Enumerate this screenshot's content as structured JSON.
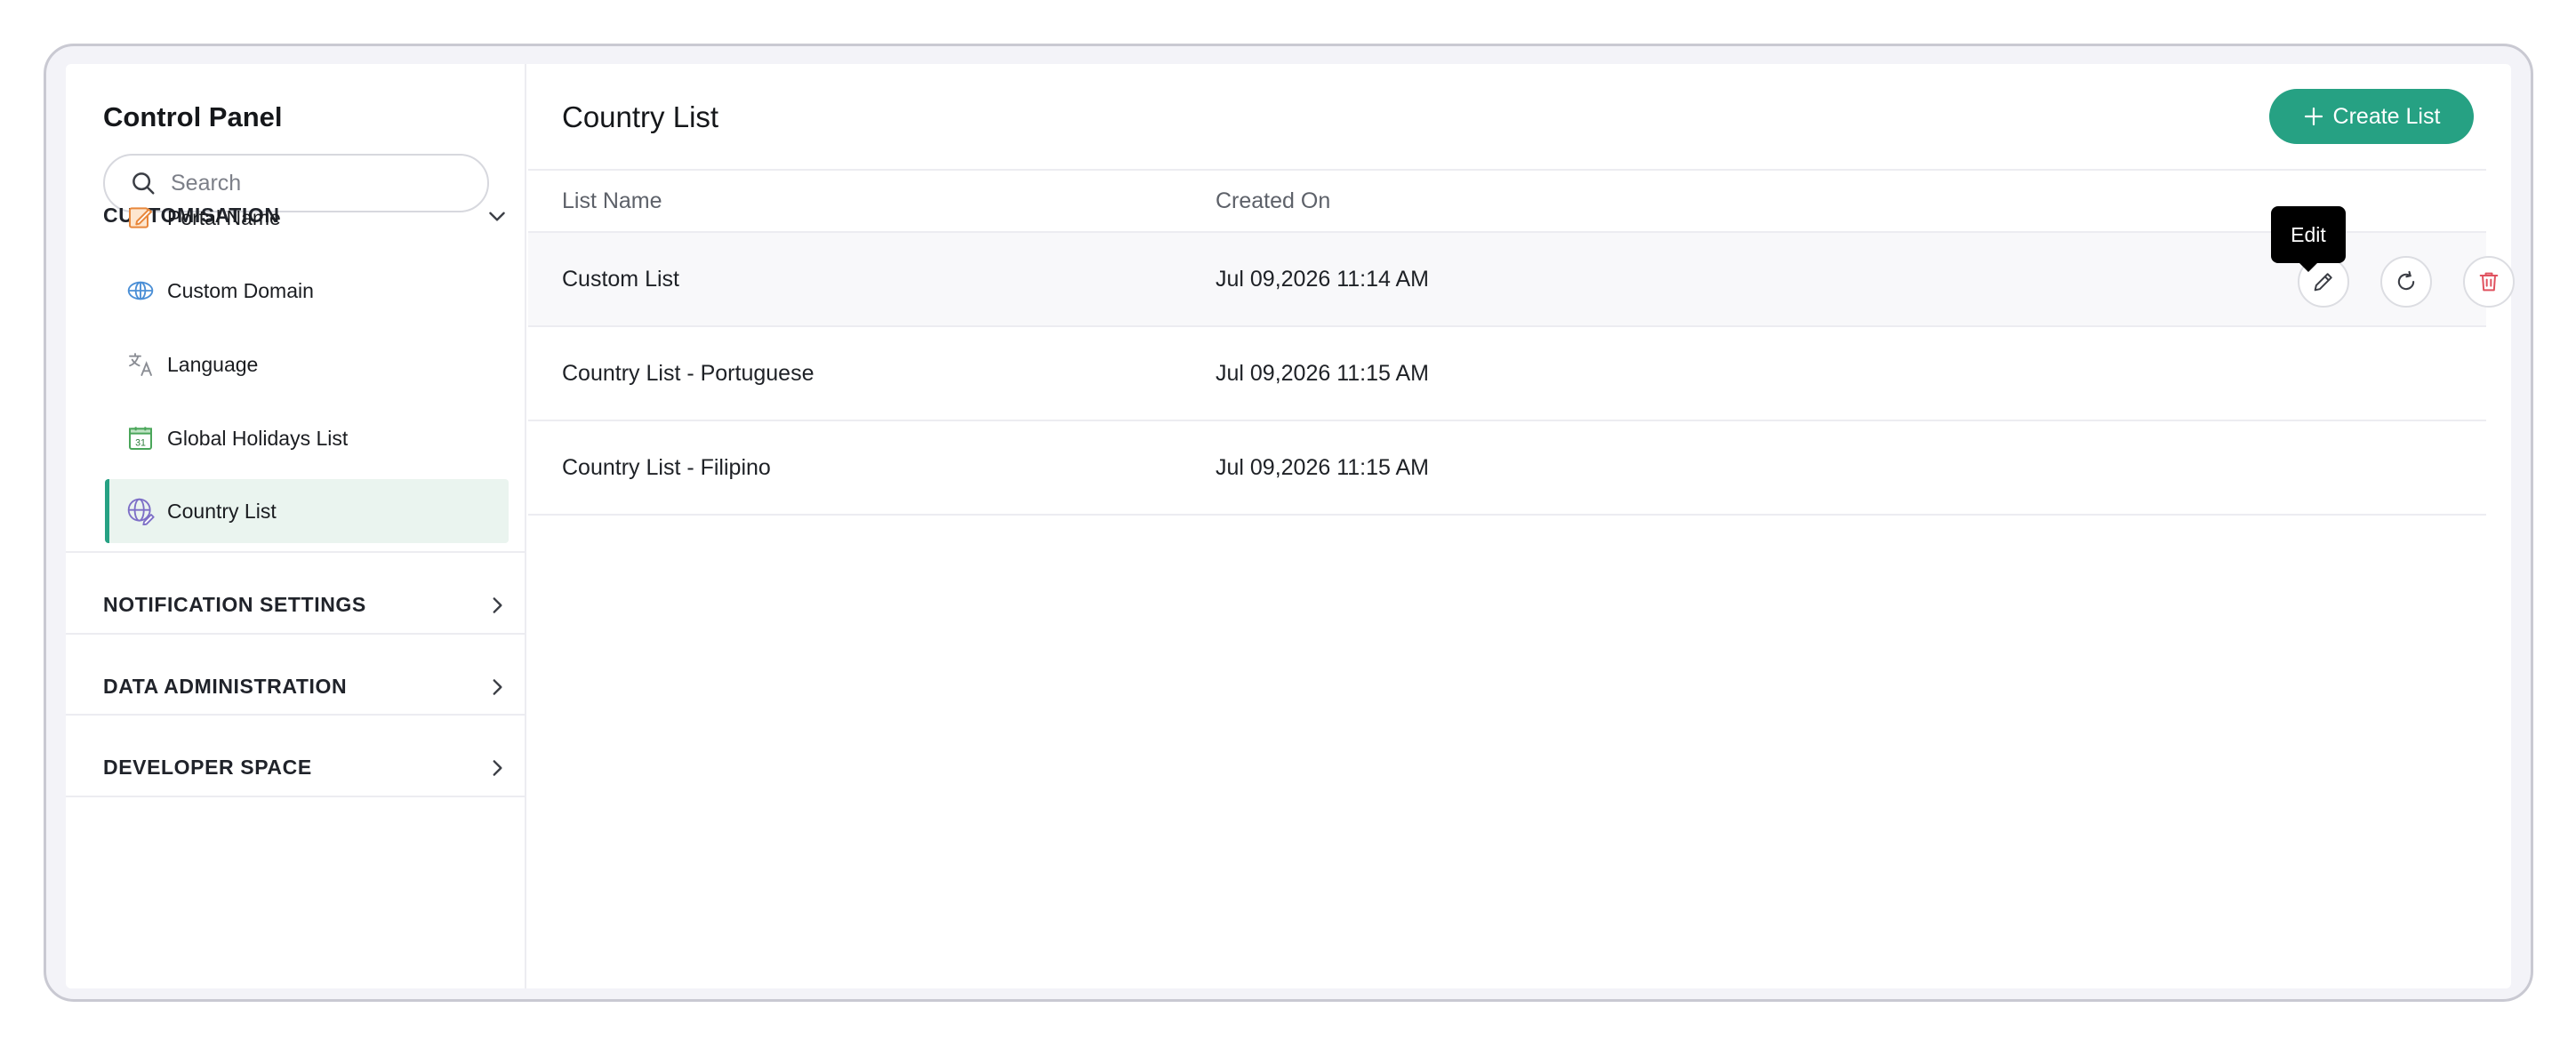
{
  "sidebar": {
    "title": "Control Panel",
    "search_placeholder": "Search",
    "sections": [
      {
        "label": "CUSTOMISATION",
        "expanded": true
      },
      {
        "label": "NOTIFICATION SETTINGS",
        "expanded": false
      },
      {
        "label": "DATA ADMINISTRATION",
        "expanded": false
      },
      {
        "label": "DEVELOPER SPACE",
        "expanded": false
      }
    ],
    "items": [
      {
        "label": "Portal Name",
        "icon": "edit-note-icon"
      },
      {
        "label": "Custom Domain",
        "icon": "globe-icon"
      },
      {
        "label": "Language",
        "icon": "translate-icon"
      },
      {
        "label": "Global Holidays List",
        "icon": "calendar-icon",
        "badge": "31"
      },
      {
        "label": "Country List",
        "icon": "globe-edit-icon",
        "active": true
      }
    ]
  },
  "main": {
    "title": "Country List",
    "create_label": "Create List",
    "columns": [
      "List Name",
      "Created On"
    ],
    "rows": [
      {
        "name": "Custom List",
        "created": "Jul 09,2026 11:14 AM"
      },
      {
        "name": "Country List - Portuguese",
        "created": "Jul 09,2026 11:15 AM"
      },
      {
        "name": "Country List - Filipino",
        "created": "Jul 09,2026 11:15 AM"
      }
    ],
    "tooltip": "Edit"
  },
  "colors": {
    "accent": "#26a183",
    "delete": "#e0525f",
    "active_bg": "#eaf4ef"
  }
}
